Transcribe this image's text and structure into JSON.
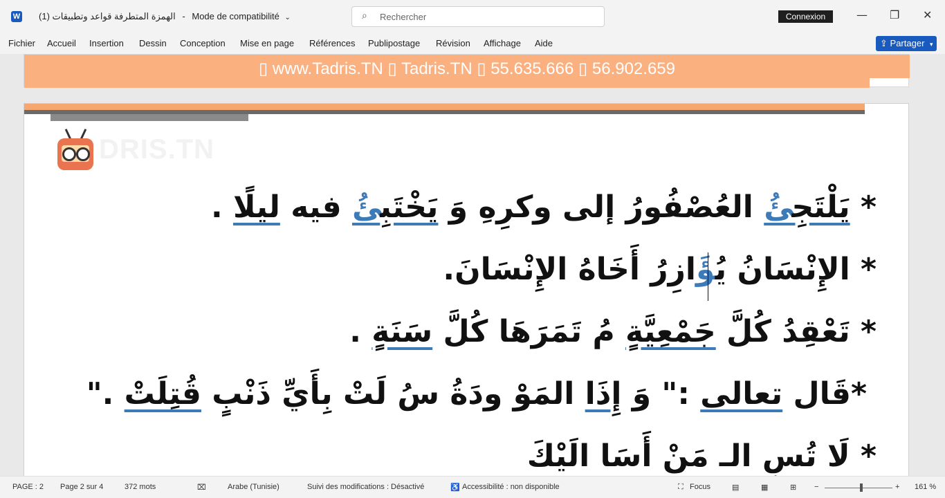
{
  "titlebar": {
    "app_icon_letter": "W",
    "doc_name": "الهمزة المتطرفة  قواعد وتطبيقات (1)",
    "separator": "-",
    "mode": "Mode de compatibilité",
    "search_placeholder": "Rechercher",
    "signin_label": "Connexion",
    "minimize": "—",
    "maximize": "❐",
    "close": "✕"
  },
  "menu": {
    "items": [
      "Fichier",
      "Accueil",
      "Insertion",
      "Dessin",
      "Conception",
      "Mise en page",
      "Références",
      "Publipostage",
      "Révision",
      "Affichage",
      "Aide"
    ],
    "share_label": "Partager"
  },
  "document": {
    "banner_text": "▯ www.Tadris.TN  ▯  Tadris.TN  ▯ 55.635.666 ▯ 56.902.659",
    "watermark": "DRIS.TN",
    "lines": [
      {
        "bullet": "* ",
        "parts": [
          {
            "text": "يَلْتَجِ",
            "blue": false,
            "ul": true
          },
          {
            "text": "ئُ",
            "blue": true,
            "ul": true
          },
          {
            "text": " العُصْفُورُ إلى وكرِهِ وَ ",
            "blue": false,
            "ul": false
          },
          {
            "text": "يَخْتَبِ",
            "blue": false,
            "ul": true
          },
          {
            "text": "ئُ",
            "blue": true,
            "ul": true
          },
          {
            "text": " فيه ",
            "blue": false,
            "ul": false
          },
          {
            "text": "ليلًا",
            "blue": false,
            "ul": true
          },
          {
            "text": " .",
            "blue": false,
            "ul": false
          }
        ]
      },
      {
        "bullet": "* ",
        "parts": [
          {
            "text": "الإِنْسَانُ ",
            "blue": false,
            "ul": false
          },
          {
            "text": "يُ",
            "blue": false,
            "ul": false
          },
          {
            "text": "ؤَ",
            "blue": true,
            "ul": false
          },
          {
            "text": "ازِرُ أَخَاهُ الإِنْسَانَ.",
            "blue": false,
            "ul": false
          }
        ]
      },
      {
        "bullet": "* ",
        "parts": [
          {
            "text": "تَعْقِدُ كُلَّ ",
            "blue": false,
            "ul": false
          },
          {
            "text": "جَمْعِيَّةٍ",
            "blue": false,
            "ul": true
          },
          {
            "text": " مُ   تَمَرَهَا كُلَّ ",
            "blue": false,
            "ul": false
          },
          {
            "text": "سَنَةٍ",
            "blue": false,
            "ul": true
          },
          {
            "text": " .",
            "blue": false,
            "ul": false
          }
        ]
      },
      {
        "bullet": "*",
        "parts": [
          {
            "text": "قَال ",
            "blue": false,
            "ul": false
          },
          {
            "text": "تعالى",
            "blue": false,
            "ul": true
          },
          {
            "text": " :\" وَ ",
            "blue": false,
            "ul": false
          },
          {
            "text": "إِذَا",
            "blue": false,
            "ul": true
          },
          {
            "text": " المَوْ   ودَةُ سُ لَتْ بِأَيِّ ذَنْبٍ ",
            "blue": false,
            "ul": false
          },
          {
            "text": "قُتِلَتْ",
            "blue": false,
            "ul": true
          },
          {
            "text": " .\"",
            "blue": false,
            "ul": false
          }
        ]
      },
      {
        "bullet": "* ",
        "parts": [
          {
            "text": "لَا تُسِ   الـ مَنْ أَسَا   الَيْكَ",
            "blue": false,
            "ul": false
          }
        ]
      }
    ]
  },
  "status": {
    "page": "PAGE : 2",
    "page_of": "Page 2 sur 4",
    "words": "372 mots",
    "language": "Arabe (Tunisie)",
    "tracking": "Suivi des modifications : Désactivé",
    "accessibility": "Accessibilité : non disponible",
    "focus": "Focus",
    "zoom_minus": "−",
    "zoom_plus": "+",
    "zoom": "161 %"
  }
}
